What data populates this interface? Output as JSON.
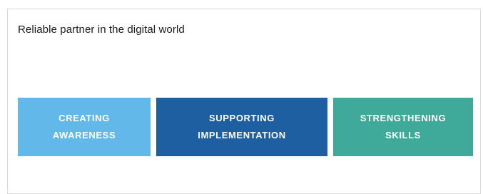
{
  "card": {
    "heading": "Reliable partner in the digital world"
  },
  "tiles": [
    {
      "label": "CREATING\nAWARENESS",
      "color": "#62b8e8"
    },
    {
      "label": "SUPPORTING\nIMPLEMENTATION",
      "color": "#1d5fa1"
    },
    {
      "label": "STRENGTHENING\nSKILLS",
      "color": "#3fa99a"
    }
  ]
}
